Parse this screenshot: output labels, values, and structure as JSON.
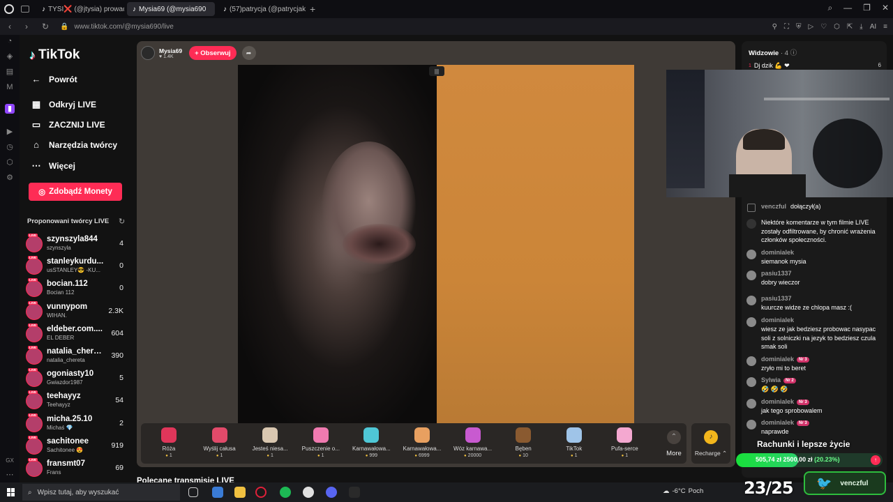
{
  "browser": {
    "tabs": [
      {
        "label": "TYSI❌ (@jtysia) prowadz",
        "active": false
      },
      {
        "label": "Mysia69 (@mysia690",
        "active": true
      },
      {
        "label": "(57)patrycja (@patrycjaku",
        "active": false
      }
    ],
    "url": "www.tiktok.com/@mysia690/live",
    "ai_label": "AI"
  },
  "sidebar": {
    "brand": "TikTok",
    "back": "Powrót",
    "menu": [
      {
        "label": "Odkryj LIVE",
        "icon": "calendar-live-icon"
      },
      {
        "label": "ZACZNIJ LIVE",
        "icon": "video-camera-icon"
      },
      {
        "label": "Narzędzia twórcy",
        "icon": "home-tools-icon"
      },
      {
        "label": "Więcej",
        "icon": "more-dots-icon"
      }
    ],
    "coins_button": "Zdobądź Monety",
    "suggested_title": "Proponowani twórcy LIVE",
    "creators": [
      {
        "name": "szynszyla844",
        "sub": "szynszyla",
        "count": "4"
      },
      {
        "name": "stanleykurdu...",
        "sub": "usSTANLEY😎 -KU...",
        "count": "0"
      },
      {
        "name": "bocian.112",
        "sub": "Bocian 112",
        "count": "0"
      },
      {
        "name": "vunnypom",
        "sub": "WIHAN.",
        "count": "2.3K"
      },
      {
        "name": "eldeber.com....",
        "sub": "EL DEBER",
        "count": "604"
      },
      {
        "name": "natalia_chere...",
        "sub": "natalia_chereta",
        "count": "390"
      },
      {
        "name": "ogoniasty10",
        "sub": "Gwiazdor1987",
        "count": "5"
      },
      {
        "name": "teehayyz",
        "sub": "Teehayyz",
        "count": "54"
      },
      {
        "name": "micha.25.10",
        "sub": "Michaś 💎",
        "count": "2"
      },
      {
        "name": "sachitonee",
        "sub": "Sachitonee 😍",
        "count": "919"
      },
      {
        "name": "fransmt07",
        "sub": "Frans",
        "count": "69"
      }
    ]
  },
  "live": {
    "host_name": "Mysia69",
    "host_likes": "♥ 1.4K",
    "follow_label": "+ Obserwuj",
    "gifts": [
      {
        "name": "Róża",
        "price": "1",
        "color": "#e0365a"
      },
      {
        "name": "Wyślij całusa",
        "price": "1",
        "color": "#e24a6a"
      },
      {
        "name": "Jesteś niesa...",
        "price": "1",
        "color": "#d9c7b0"
      },
      {
        "name": "Puszczenie o...",
        "price": "1",
        "color": "#f07ab0"
      },
      {
        "name": "Karnawałowa...",
        "price": "999",
        "color": "#4fc7d6"
      },
      {
        "name": "Karnawałowa...",
        "price": "6999",
        "color": "#e8a060"
      },
      {
        "name": "Wóz karnawa...",
        "price": "20000",
        "color": "#c85ad0"
      },
      {
        "name": "Bęben",
        "price": "10",
        "color": "#8a5a30"
      },
      {
        "name": "TikTok",
        "price": "1",
        "color": "#9fc4e8"
      },
      {
        "name": "Pufa-serce",
        "price": "1",
        "color": "#f4a8d0"
      }
    ],
    "more_label": "More",
    "recharge_label": "Recharge ⌃",
    "recommended": "Polecane transmisje LIVE"
  },
  "chat": {
    "viewers_label": "Widzowie",
    "viewers_count": "· 4",
    "top_viewer": "Dj dzik 💪 ❤",
    "top_viewer_rank": "1",
    "top_viewer_score": "6",
    "messages": [
      {
        "user": "venczful",
        "text": "dołączył(a)",
        "type": "join"
      },
      {
        "user": "",
        "text": "Niektóre komentarze w tym filmie LIVE zostały odfiltrowane, by chronić wrażenia członków społeczności.",
        "type": "system"
      },
      {
        "user": "dominialek",
        "text": "siemanok mysia",
        "badge": ""
      },
      {
        "user": "pasiu1337",
        "text": "dobry wieczor",
        "badge": ""
      },
      {
        "user": "pasiu1337",
        "text": "kuurcze widze ze chlopa masz :(",
        "badge": ""
      },
      {
        "user": "dominialek",
        "text": "wiesz ze jak bedziesz probowac nasypac soli z solniczki na jezyk to bedziesz czula smak soli",
        "badge": ""
      },
      {
        "user": "dominialek",
        "text": "zryło mi to beret",
        "badge": "Nr 3"
      },
      {
        "user": "Sylwia",
        "text": "🤣 🤣 🤣",
        "badge": "Nr 2"
      },
      {
        "user": "dominialek",
        "text": "jak tego sprobowalem",
        "badge": "Nr 3"
      },
      {
        "user": "dominialek",
        "text": "naprawde",
        "badge": "Nr 3"
      }
    ]
  },
  "overlay": {
    "bills_title": "Rachunki i lepsze życie",
    "bills_amount": "505,74 zł",
    "bills_goal": "2500,00 zł",
    "bills_pct": "(20.23%)",
    "bills_fraction": 0.2023,
    "counter": "23/25",
    "twitter_name": "venczful"
  },
  "taskbar": {
    "search_placeholder": "Wpisz tutaj, aby wyszukać",
    "temperature": "-6°C",
    "weather_text": "Poch"
  }
}
